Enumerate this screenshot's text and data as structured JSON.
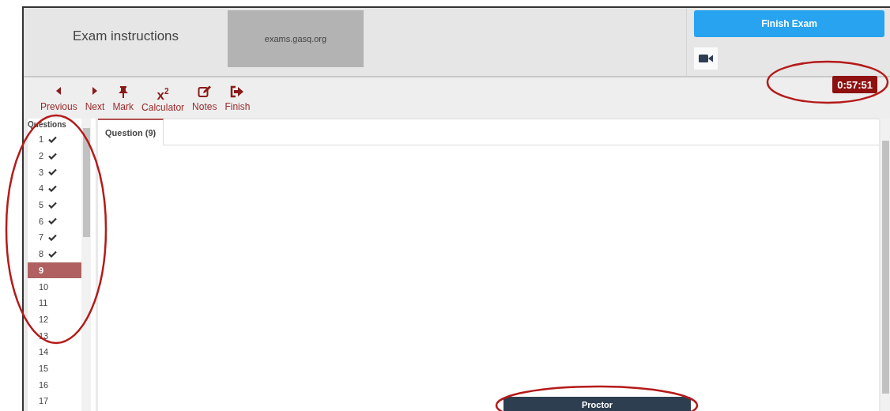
{
  "header": {
    "title": "Exam instructions",
    "site": "exams.gasq.org",
    "finish_button": "Finish Exam"
  },
  "toolbar": [
    {
      "kind": "prev",
      "label": "Previous"
    },
    {
      "kind": "next",
      "label": "Next"
    },
    {
      "kind": "mark",
      "label": "Mark"
    },
    {
      "kind": "calc",
      "label": "Calculator",
      "symbol": "x",
      "power": "2"
    },
    {
      "kind": "notes",
      "label": "Notes"
    },
    {
      "kind": "finish",
      "label": "Finish"
    }
  ],
  "timer": "0:57:51",
  "sidebar": {
    "title": "Questions",
    "items": [
      {
        "label": "1",
        "answered": true,
        "selected": false
      },
      {
        "label": "2",
        "answered": true,
        "selected": false
      },
      {
        "label": "3",
        "answered": true,
        "selected": false
      },
      {
        "label": "4",
        "answered": true,
        "selected": false
      },
      {
        "label": "5",
        "answered": true,
        "selected": false
      },
      {
        "label": "6",
        "answered": true,
        "selected": false
      },
      {
        "label": "7",
        "answered": true,
        "selected": false
      },
      {
        "label": "8",
        "answered": true,
        "selected": false
      },
      {
        "label": "9",
        "answered": false,
        "selected": true
      },
      {
        "label": "10",
        "answered": false,
        "selected": false
      },
      {
        "label": "11",
        "answered": false,
        "selected": false
      },
      {
        "label": "12",
        "answered": false,
        "selected": false
      },
      {
        "label": "13",
        "answered": false,
        "selected": false
      },
      {
        "label": "14",
        "answered": false,
        "selected": false
      },
      {
        "label": "15",
        "answered": false,
        "selected": false
      },
      {
        "label": "16",
        "answered": false,
        "selected": false
      },
      {
        "label": "17",
        "answered": false,
        "selected": false
      }
    ]
  },
  "tabs": [
    {
      "label": "Question (9)",
      "selected": true
    }
  ],
  "proctor_button": "Proctor"
}
